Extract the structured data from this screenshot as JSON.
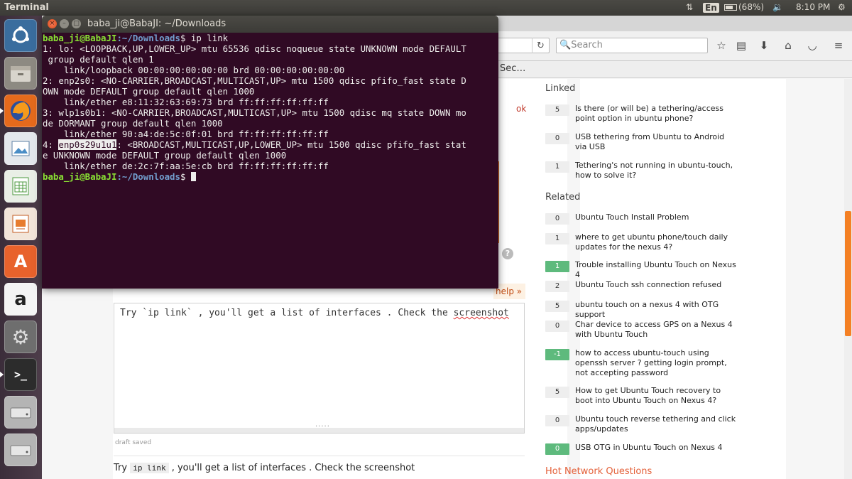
{
  "top_panel": {
    "app_title": "Terminal",
    "language": "En",
    "battery": "(68%)",
    "volume_icon": "volume-icon",
    "network_icon": "network-arrows-icon",
    "time": "8:10 PM",
    "gear_icon": "power-gear-icon"
  },
  "launcher": {
    "items": [
      "ubuntu-dash",
      "files",
      "firefox",
      "image-viewer",
      "libreoffice-calc",
      "libreoffice-impress",
      "software-center",
      "amazon",
      "system-settings",
      "terminal",
      "disk-drive-1",
      "disk-drive-2"
    ],
    "active": "terminal"
  },
  "browser": {
    "search_placeholder": "Search",
    "bookmark_partial": "Sec…",
    "ok_link": "ok",
    "help_link": "help »",
    "help_icon": "?",
    "editor_text_parts": [
      "Try `ip link` , you'll get a list of interfaces . Check the ",
      "screenshot"
    ],
    "draft_status": "draft saved",
    "preview_parts": [
      "Try ",
      "ip link",
      " , you'll get a list of interfaces . Check the screenshot"
    ]
  },
  "sidebar": {
    "linked_heading": "Linked",
    "linked": [
      {
        "score": "5",
        "title": "Is there (or will be) a tethering/access point option in ubuntu phone?",
        "accepted": false
      },
      {
        "score": "0",
        "title": "USB tethering from Ubuntu to Android via USB",
        "accepted": false
      },
      {
        "score": "1",
        "title": "Tethering's not running in ubuntu-touch, how to solve it?",
        "accepted": false
      }
    ],
    "related_heading": "Related",
    "related": [
      {
        "score": "0",
        "title": "Ubuntu Touch Install Problem",
        "accepted": false
      },
      {
        "score": "1",
        "title": "where to get ubuntu phone/touch daily updates for the nexus 4?",
        "accepted": false
      },
      {
        "score": "1",
        "title": "Trouble installing Ubuntu Touch on Nexus 4",
        "accepted": true
      },
      {
        "score": "2",
        "title": "Ubuntu Touch ssh connection refused",
        "accepted": false
      },
      {
        "score": "5",
        "title": "ubuntu touch on a nexus 4 with OTG support",
        "accepted": false
      },
      {
        "score": "0",
        "title": "Char device to access GPS on a Nexus 4 with Ubuntu Touch",
        "accepted": false
      },
      {
        "score": "-1",
        "title": "how to access ubuntu-touch using openssh server ? getting login prompt, not accepting password",
        "accepted": true
      },
      {
        "score": "5",
        "title": "How to get Ubuntu Touch recovery to boot into Ubuntu Touch on Nexus 4?",
        "accepted": false
      },
      {
        "score": "0",
        "title": "Ubuntu touch reverse tethering and click apps/updates",
        "accepted": false
      },
      {
        "score": "0",
        "title": "USB OTG in Ubuntu Touch on Nexus 4",
        "accepted": true
      }
    ],
    "hot_heading": "Hot Network Questions"
  },
  "terminal": {
    "title": "baba_ji@BabaJI: ~/Downloads",
    "prompt_user": "baba_ji@BabaJI",
    "prompt_path": ":~/Downloads",
    "prompt_dollar": "$ ",
    "command": "ip link",
    "lines": [
      "1: lo: <LOOPBACK,UP,LOWER_UP> mtu 65536 qdisc noqueue state UNKNOWN mode DEFAULT",
      " group default qlen 1",
      "    link/loopback 00:00:00:00:00:00 brd 00:00:00:00:00:00",
      "2: enp2s0: <NO-CARRIER,BROADCAST,MULTICAST,UP> mtu 1500 qdisc pfifo_fast state D",
      "OWN mode DEFAULT group default qlen 1000",
      "    link/ether e8:11:32:63:69:73 brd ff:ff:ff:ff:ff:ff",
      "3: wlp1s0b1: <NO-CARRIER,BROADCAST,MULTICAST,UP> mtu 1500 qdisc mq state DOWN mo",
      "de DORMANT group default qlen 1000",
      "    link/ether 90:a4:de:5c:0f:01 brd ff:ff:ff:ff:ff:ff"
    ],
    "line4_prefix": "4: ",
    "line4_selected": "enp0s29u1u1",
    "line4_rest": ": <BROADCAST,MULTICAST,UP,LOWER_UP> mtu 1500 qdisc pfifo_fast stat",
    "lines_after": [
      "e UNKNOWN mode DEFAULT group default qlen 1000",
      "    link/ether de:2c:7f:aa:5e:cb brd ff:ff:ff:ff:ff:ff"
    ]
  },
  "colors": {
    "terminal_bg": "#300a24",
    "prompt_user": "#8ae234",
    "prompt_path": "#729fcf",
    "accepted_green": "#5eba7d",
    "hot_orange": "#e4613a"
  }
}
